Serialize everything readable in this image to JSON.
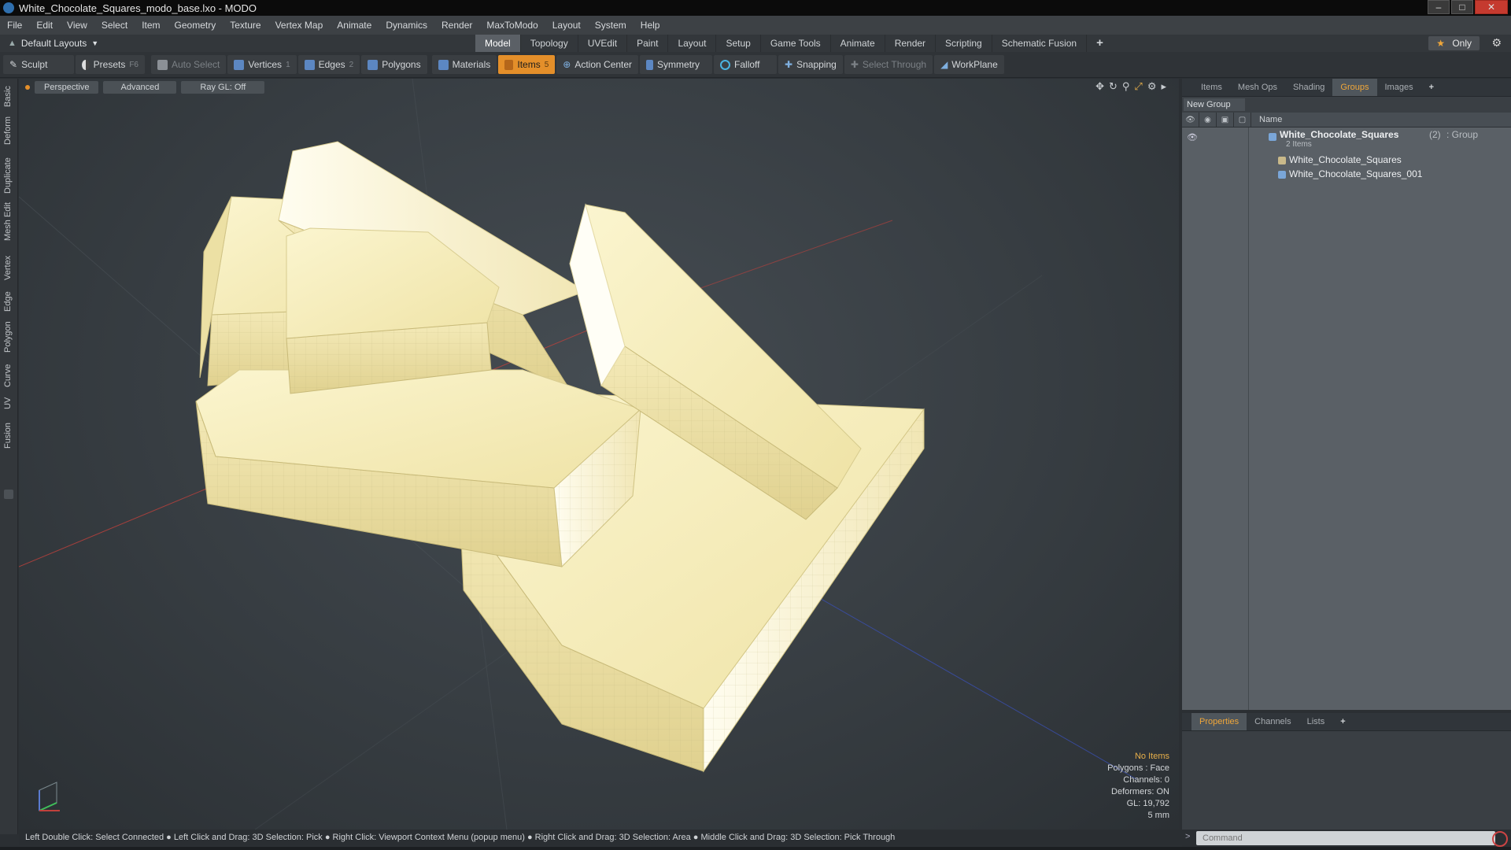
{
  "window": {
    "title": "White_Chocolate_Squares_modo_base.lxo - MODO",
    "controls": [
      "–",
      "□",
      "✕"
    ]
  },
  "menu": [
    "File",
    "Edit",
    "View",
    "Select",
    "Item",
    "Geometry",
    "Texture",
    "Vertex Map",
    "Animate",
    "Dynamics",
    "Render",
    "MaxToModo",
    "Layout",
    "System",
    "Help"
  ],
  "layoutbar": {
    "layout_name": "Default Layouts",
    "tabs": [
      "Model",
      "Topology",
      "UVEdit",
      "Paint",
      "Layout",
      "Setup",
      "Game Tools",
      "Animate",
      "Render",
      "Scripting",
      "Schematic Fusion"
    ],
    "active_tab": "Model",
    "add": "+",
    "only_label": "Only"
  },
  "toolbar": {
    "sculpt": "Sculpt",
    "presets": "Presets",
    "presets_key": "F6",
    "auto_select": "Auto Select",
    "vertices": "Vertices",
    "vertices_key": "1",
    "edges": "Edges",
    "edges_key": "2",
    "polygons": "Polygons",
    "materials": "Materials",
    "items": "Items",
    "items_key": "5",
    "action_center": "Action Center",
    "symmetry": "Symmetry",
    "falloff": "Falloff",
    "snapping": "Snapping",
    "select_through": "Select Through",
    "workplane": "WorkPlane"
  },
  "lefttabs": [
    "Basic",
    "Deform",
    "Duplicate",
    "Mesh Edit",
    "Vertex",
    "Edge",
    "Polygon",
    "Curve",
    "UV",
    "Fusion"
  ],
  "viewport": {
    "view": "Perspective",
    "mode": "Advanced",
    "raygl": "Ray GL: Off",
    "info": {
      "no_items": "No Items",
      "polygons": "Polygons : Face",
      "channels": "Channels: 0",
      "deformers": "Deformers: ON",
      "gl": "GL: 19,792",
      "scale": "5 mm"
    }
  },
  "right_panel": {
    "tabs": [
      "Items",
      "Mesh Ops",
      "Shading",
      "Groups",
      "Images",
      "+"
    ],
    "active_tab": "Groups",
    "new_group": "New Group",
    "col_name": "Name",
    "group": {
      "name": "White_Chocolate_Squares",
      "count": "(2)",
      "type": ": Group",
      "sub": "2 Items",
      "children": [
        "White_Chocolate_Squares",
        "White_Chocolate_Squares_001"
      ]
    }
  },
  "properties_panel": {
    "tabs": [
      "Properties",
      "Channels",
      "Lists",
      "+"
    ],
    "active_tab": "Properties"
  },
  "statusbar": {
    "hint": "Left Double Click: Select Connected ● Left Click and Drag: 3D Selection: Pick ● Right Click: Viewport Context Menu (popup menu) ● Right Click and Drag: 3D Selection: Area ● Middle Click and Drag: 3D Selection: Pick Through"
  },
  "command": {
    "placeholder": "Command"
  }
}
